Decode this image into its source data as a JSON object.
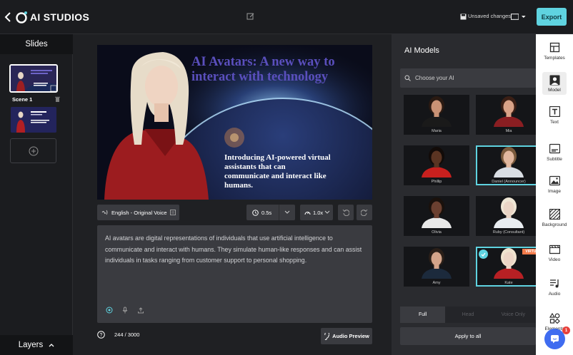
{
  "app": {
    "logo_text": "AI STUDIOS",
    "unsaved_label": "Unsaved changes",
    "export_label": "Export",
    "accent": "#5fd3e0"
  },
  "slides": {
    "header": "Slides",
    "scene_label": "Scene 1",
    "layers_label": "Layers"
  },
  "canvas": {
    "title": "AI Avatars: A new way to interact with technology",
    "body": "Introducing AI-powered virtual assistants that can communicate and interact like humans."
  },
  "controls": {
    "voice_label": "English - Original Voice",
    "pause_value": "0.5s",
    "speed_value": "1.0x"
  },
  "script": {
    "text": "AI avatars are digital representations of individuals that use artificial intelligence to communicate and interact with humans. They simulate human-like responses and can assist individuals in tasks ranging from customer support to personal shopping.",
    "char_count": "244",
    "char_limit": "/ 3000",
    "audio_preview_label": "Audio Preview"
  },
  "models": {
    "title": "AI Models",
    "search_placeholder": "Choose your AI",
    "items": [
      {
        "name": "Maria",
        "skin": "#c99275",
        "hair": "#2a1a12",
        "shirt": "#1a1a1a",
        "selected": false
      },
      {
        "name": "Mia",
        "skin": "#d9a287",
        "hair": "#3b1f15",
        "shirt": "#8a1e22",
        "selected": false
      },
      {
        "name": "Phillip",
        "skin": "#5a3422",
        "hair": "#120b08",
        "shirt": "#c8201e",
        "selected": false
      },
      {
        "name": "Daniel (Announcer)",
        "skin": "#e1b79e",
        "hair": "#7a5a3c",
        "shirt": "#d9dde3",
        "selected": true
      },
      {
        "name": "Olivia",
        "skin": "#6b4030",
        "hair": "#1a110c",
        "shirt": "#e8e8e8",
        "selected": false
      },
      {
        "name": "Ruby (Consultant)",
        "skin": "#ead4c5",
        "hair": "#efe6d5",
        "shirt": "#e8ecf0",
        "selected": false
      },
      {
        "name": "Amy",
        "skin": "#d4a48a",
        "hair": "#2a1f18",
        "shirt": "#1c2a3c",
        "selected": false
      },
      {
        "name": "Kate",
        "skin": "#ecd5c6",
        "hair": "#efe3cf",
        "shirt": "#b72024",
        "selected": true,
        "badge": "VIRTUA"
      }
    ],
    "tabs": [
      {
        "label": "Full",
        "active": true
      },
      {
        "label": "Head",
        "active": false
      },
      {
        "label": "Voice Only",
        "active": false
      }
    ],
    "apply_label": "Apply to all"
  },
  "rail": {
    "items": [
      {
        "label": "Templates",
        "icon": "templates-icon"
      },
      {
        "label": "Model",
        "icon": "model-icon"
      },
      {
        "label": "Text",
        "icon": "text-icon"
      },
      {
        "label": "Subtitle",
        "icon": "subtitle-icon"
      },
      {
        "label": "Image",
        "icon": "image-icon"
      },
      {
        "label": "Background",
        "icon": "background-icon"
      },
      {
        "label": "Video",
        "icon": "video-icon"
      },
      {
        "label": "Audio",
        "icon": "audio-icon"
      },
      {
        "label": "Elements",
        "icon": "shapes-icon"
      }
    ],
    "chat_badge": "1"
  }
}
